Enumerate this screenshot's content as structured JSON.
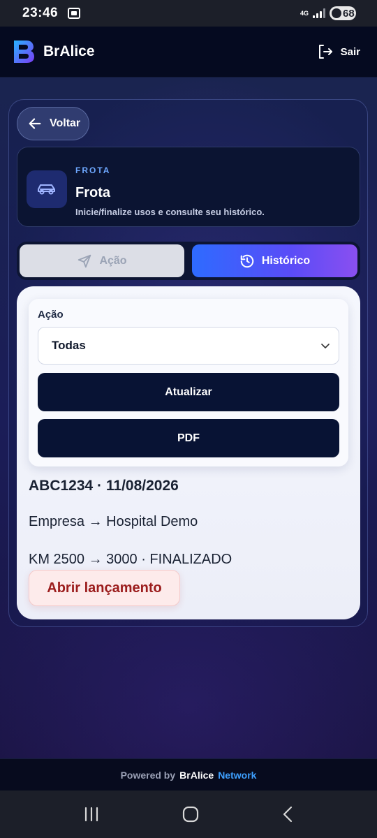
{
  "status_bar": {
    "time": "23:46",
    "network": "4G",
    "battery": "68"
  },
  "header": {
    "brand": "BrAlice",
    "logout_label": "Sair"
  },
  "back_button": {
    "label": "Voltar"
  },
  "module": {
    "overline": "FROTA",
    "title": "Frota",
    "description": "Inicie/finalize usos e consulte seu histórico."
  },
  "tabs": [
    {
      "label": "Ação",
      "active": false
    },
    {
      "label": "Histórico",
      "active": true
    }
  ],
  "filter": {
    "label": "Ação",
    "selected": "Todas",
    "refresh_label": "Atualizar",
    "pdf_label": "PDF"
  },
  "record": {
    "title": "ABC1234 · 11/08/2026",
    "company_line": "Empresa → Hospital Demo",
    "km_line": "KM 2500 → 3000 · FINALIZADO",
    "open_label": "Abrir lançamento"
  },
  "footer": {
    "powered": "Powered by",
    "brand": "BrAlice",
    "network": "Network"
  },
  "colors": {
    "accent_blue": "#2e6bff",
    "accent_purple": "#8a4ff0",
    "dark_button": "#081334",
    "danger": "#9b1c1c"
  }
}
